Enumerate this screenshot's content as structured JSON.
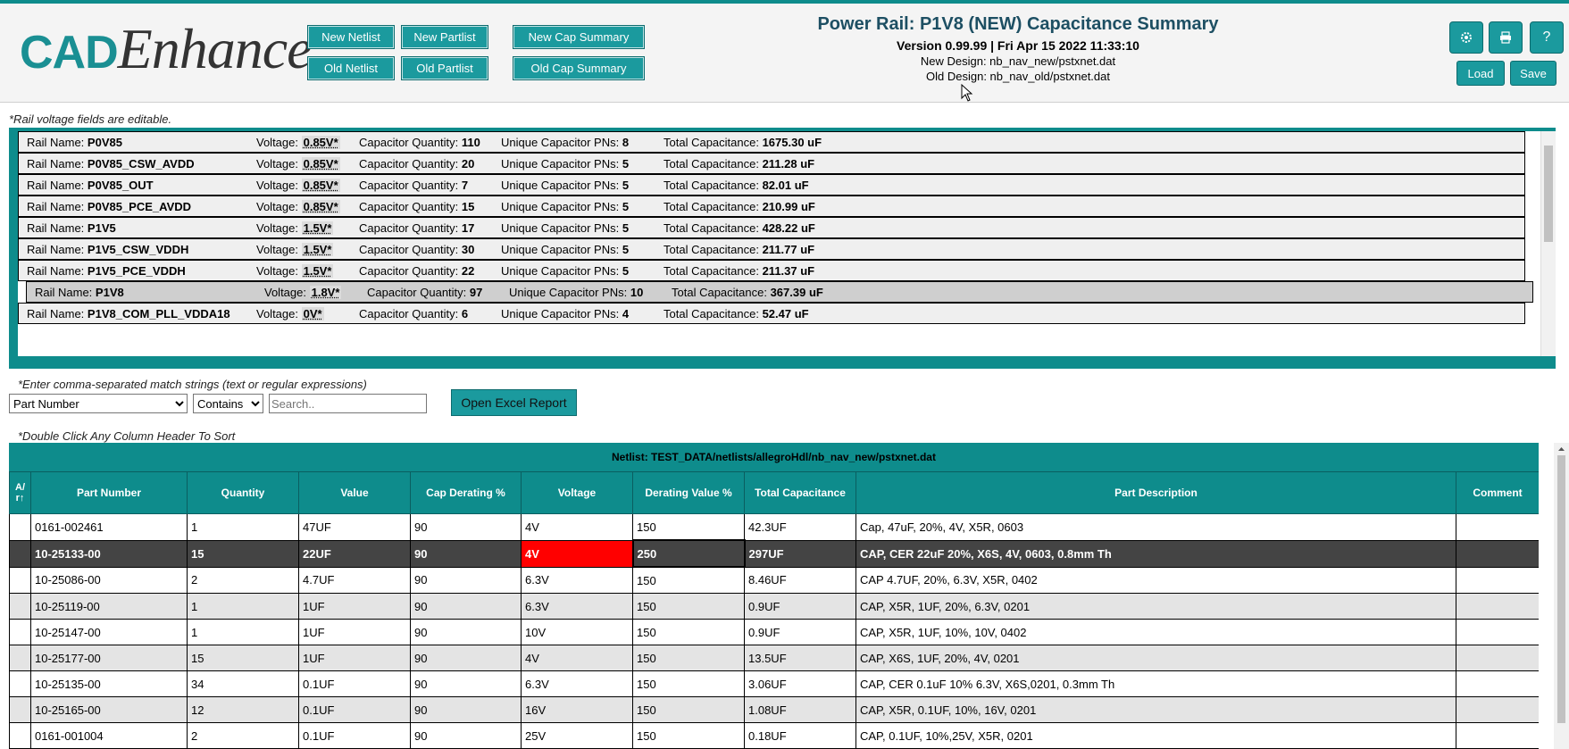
{
  "header": {
    "logo_cad": "CAD",
    "logo_enhance": "Enhance",
    "buttons": {
      "new_netlist": "New Netlist",
      "new_partlist": "New Partlist",
      "new_cap_summary": "New Cap Summary",
      "old_netlist": "Old Netlist",
      "old_partlist": "Old Partlist",
      "old_cap_summary": "Old Cap Summary",
      "load": "Load",
      "save": "Save"
    },
    "title": "Power Rail: P1V8 (NEW) Capacitance Summary",
    "version": "Version 0.99.99 | Fri Apr 15 2022 11:33:10",
    "new_design": "New Design: nb_nav_new/pstxnet.dat",
    "old_design": "Old Design: nb_nav_old/pstxnet.dat",
    "icons": [
      "gear-icon",
      "print-icon",
      "help-icon"
    ],
    "help_glyph": "?"
  },
  "rail_note": "*Rail voltage fields are editable.",
  "rail_labels": {
    "name": "Rail Name:",
    "voltage": "Voltage:",
    "qty": "Capacitor Quantity:",
    "unique": "Unique Capacitor PNs:",
    "total": "Total Capacitance:"
  },
  "rails": [
    {
      "name": "P0V85",
      "voltage": "0.85V*",
      "qty": "110",
      "unique": "8",
      "total": "1675.30 uF"
    },
    {
      "name": "P0V85_CSW_AVDD",
      "voltage": "0.85V*",
      "qty": "20",
      "unique": "5",
      "total": "211.28 uF"
    },
    {
      "name": "P0V85_OUT",
      "voltage": "0.85V*",
      "qty": "7",
      "unique": "5",
      "total": "82.01 uF"
    },
    {
      "name": "P0V85_PCE_AVDD",
      "voltage": "0.85V*",
      "qty": "15",
      "unique": "5",
      "total": "210.99 uF"
    },
    {
      "name": "P1V5",
      "voltage": "1.5V*",
      "qty": "17",
      "unique": "5",
      "total": "428.22 uF"
    },
    {
      "name": "P1V5_CSW_VDDH",
      "voltage": "1.5V*",
      "qty": "30",
      "unique": "5",
      "total": "211.77 uF"
    },
    {
      "name": "P1V5_PCE_VDDH",
      "voltage": "1.5V*",
      "qty": "22",
      "unique": "5",
      "total": "211.37 uF"
    },
    {
      "name": "P1V8",
      "voltage": "1.8V*",
      "qty": "97",
      "unique": "10",
      "total": "367.39 uF",
      "selected": true
    },
    {
      "name": "P1V8_COM_PLL_VDDA18",
      "voltage": "0V*",
      "qty": "6",
      "unique": "4",
      "total": "52.47 uF"
    }
  ],
  "filter": {
    "note": "*Enter comma-separated match strings (text or regular expressions)",
    "field": "Part Number",
    "mode": "Contains",
    "search_placeholder": "Search..",
    "excel_button": "Open Excel Report",
    "sort_note": "*Double Click Any Column Header To Sort"
  },
  "table": {
    "netlist": "Netlist: TEST_DATA/netlists/allegroHdl/nb_nav_new/pstxnet.dat",
    "sort_header": "A/\nr↑",
    "columns": [
      "Part Number",
      "Quantity",
      "Value",
      "Cap Derating %",
      "Voltage",
      "Derating Value %",
      "Total Capacitance",
      "Part Description",
      "Comment"
    ],
    "rows": [
      [
        "0161-002461",
        "1",
        "47UF",
        "90",
        "4V",
        "150",
        "42.3UF",
        "Cap, 47uF, 20%, 4V, X5R, 0603",
        ""
      ],
      [
        "10-25133-00",
        "15",
        "22UF",
        "90",
        "4V",
        "250",
        "297UF",
        "CAP, CER 22uF 20%, X6S, 4V, 0603, 0.8mm Th",
        ""
      ],
      [
        "10-25086-00",
        "2",
        "4.7UF",
        "90",
        "6.3V",
        "150",
        "8.46UF",
        "CAP 4.7UF, 20%, 6.3V, X5R, 0402",
        ""
      ],
      [
        "10-25119-00",
        "1",
        "1UF",
        "90",
        "6.3V",
        "150",
        "0.9UF",
        "CAP, X5R, 1UF, 20%, 6.3V, 0201",
        ""
      ],
      [
        "10-25147-00",
        "1",
        "1UF",
        "90",
        "10V",
        "150",
        "0.9UF",
        "CAP, X5R, 1UF, 10%, 10V, 0402",
        ""
      ],
      [
        "10-25177-00",
        "15",
        "1UF",
        "90",
        "4V",
        "150",
        "13.5UF",
        "CAP, X6S, 1UF, 20%, 4V, 0201",
        ""
      ],
      [
        "10-25135-00",
        "34",
        "0.1UF",
        "90",
        "6.3V",
        "150",
        "3.06UF",
        "CAP, CER 0.1uF 10% 6.3V, X6S,0201, 0.3mm Th",
        ""
      ],
      [
        "10-25165-00",
        "12",
        "0.1UF",
        "90",
        "16V",
        "150",
        "1.08UF",
        "CAP, X5R, 0.1UF, 10%, 16V, 0201",
        ""
      ],
      [
        "0161-001004",
        "2",
        "0.1UF",
        "90",
        "25V",
        "150",
        "0.18UF",
        "CAP, 0.1UF, 10%,25V, X5R, 0201",
        ""
      ]
    ],
    "selected_row": 1,
    "highlight": {
      "row": 1,
      "col": 4,
      "color": "#ff0000"
    }
  }
}
